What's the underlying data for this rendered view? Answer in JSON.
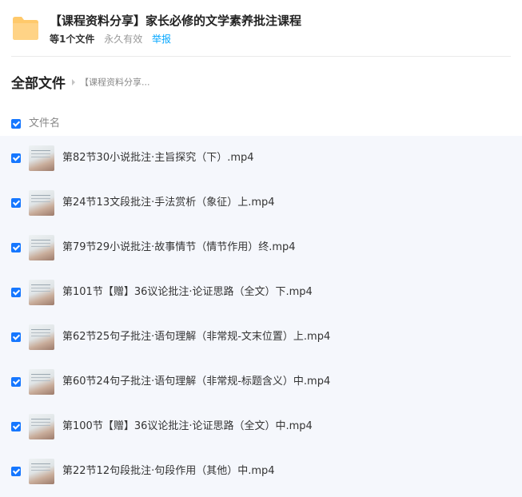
{
  "share": {
    "title": "【课程资料分享】家长必修的文学素养批注课程",
    "file_count": "等1个文件",
    "expiry": "永久有效",
    "report": "举报"
  },
  "breadcrumb": {
    "root": "全部文件",
    "current": "【课程资料分享..."
  },
  "list_header": {
    "column_name": "文件名",
    "select_all_checked": true
  },
  "files": [
    {
      "name": "第82节30小说批注·主旨探究（下）.mp4",
      "checked": true
    },
    {
      "name": "第24节13文段批注·手法赏析（象征）上.mp4",
      "checked": true
    },
    {
      "name": "第79节29小说批注·故事情节（情节作用）终.mp4",
      "checked": true
    },
    {
      "name": "第101节【赠】36议论批注·论证思路（全文）下.mp4",
      "checked": true
    },
    {
      "name": "第62节25句子批注·语句理解（非常规-文末位置）上.mp4",
      "checked": true
    },
    {
      "name": "第60节24句子批注·语句理解（非常规-标题含义）中.mp4",
      "checked": true
    },
    {
      "name": "第100节【赠】36议论批注·论证思路（全文）中.mp4",
      "checked": true
    },
    {
      "name": "第22节12句段批注·句段作用（其他）中.mp4",
      "checked": true
    }
  ],
  "colors": {
    "accent": "#1677ff",
    "link": "#06a7ff",
    "folder": "#ffc96b",
    "list_bg": "#f5f7fc"
  },
  "icons": {
    "folder": "folder-icon",
    "checkbox": "checkbox-checked-icon",
    "thumbnail": "video-thumbnail"
  }
}
